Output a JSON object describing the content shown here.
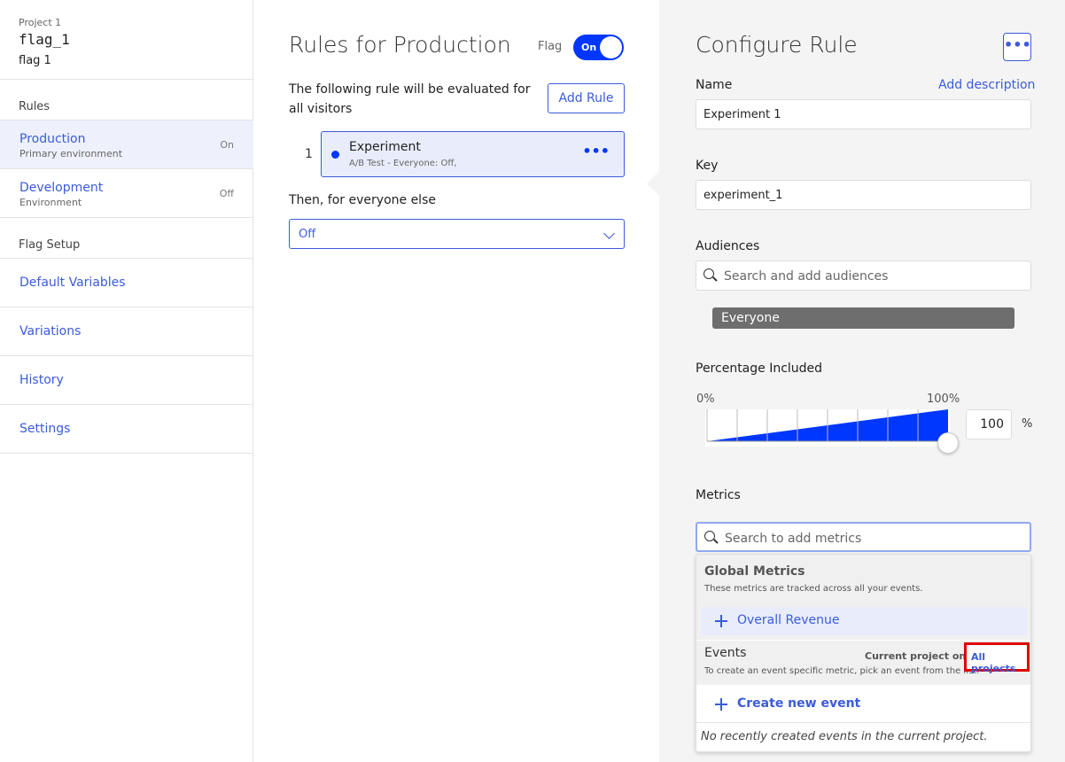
{
  "sidebar": {
    "project_label": "Project 1",
    "flag_key": "flag_1",
    "flag_name": "flag 1",
    "rules_heading": "Rules",
    "environments": [
      {
        "name": "Production",
        "subtitle": "Primary environment",
        "state": "On",
        "active": true
      },
      {
        "name": "Development",
        "subtitle": "Environment",
        "state": "Off",
        "active": false
      }
    ],
    "flag_setup_heading": "Flag Setup",
    "nav": [
      "Default Variables",
      "Variations",
      "History",
      "Settings"
    ]
  },
  "middle": {
    "title": "Rules for Production",
    "flag_label": "Flag",
    "toggle_label": "On",
    "description": "The following rule will be evaluated for all visitors",
    "add_rule_label": "Add Rule",
    "rule": {
      "number": "1",
      "title": "Experiment",
      "subtitle": "A/B Test - Everyone: Off,",
      "menu": "•••"
    },
    "then_label": "Then, for everyone else",
    "fallback_value": "Off"
  },
  "right": {
    "title": "Configure Rule",
    "more_label": "•••",
    "name_label": "Name",
    "add_description": "Add description",
    "name_value": "Experiment 1",
    "key_label": "Key",
    "key_value": "experiment_1",
    "audiences_label": "Audiences",
    "audiences_placeholder": "Search and add audiences",
    "audience_chip": "Everyone",
    "percentage_label": "Percentage Included",
    "pct_min": "0%",
    "pct_max": "100%",
    "pct_value": "100",
    "pct_sign": "%",
    "metrics_label": "Metrics",
    "metrics_placeholder": "Search to add metrics",
    "dropdown": {
      "global_heading": "Global Metrics",
      "global_sub": "These metrics are tracked across all your events.",
      "global_item": "Overall Revenue",
      "events_heading": "Events",
      "events_sub": "To create an event specific metric, pick an event from the list.",
      "current_project": "Current project only",
      "all_projects": "All projects",
      "create_event": "Create new event",
      "no_recent": "No recently created events in the current project."
    }
  },
  "colors": {
    "accent": "#3b5bdb",
    "toggle": "#0037ff",
    "highlight": "#e00000"
  },
  "slider": {
    "percentage": 100
  }
}
